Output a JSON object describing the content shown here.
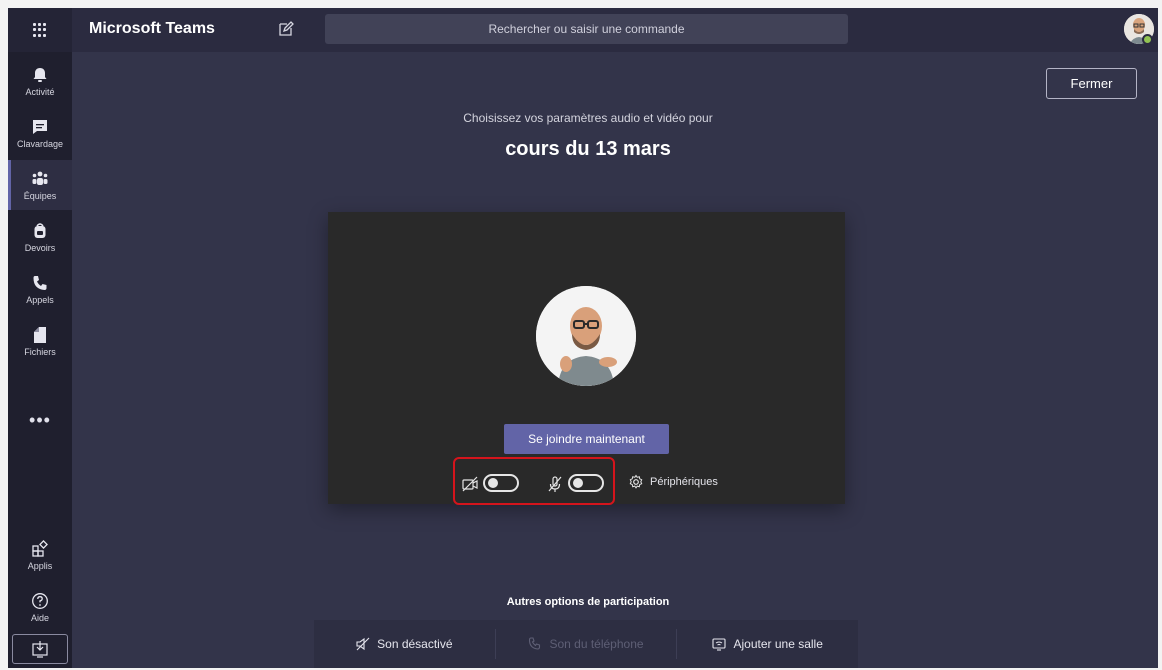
{
  "topbar": {
    "app_title": "Microsoft Teams",
    "search_placeholder": "Rechercher ou saisir une commande"
  },
  "sidebar": {
    "items": [
      {
        "label": "Activité",
        "icon": "bell-icon"
      },
      {
        "label": "Clavardage",
        "icon": "chat-icon"
      },
      {
        "label": "Équipes",
        "icon": "teams-icon",
        "active": true
      },
      {
        "label": "Devoirs",
        "icon": "backpack-icon"
      },
      {
        "label": "Appels",
        "icon": "phone-icon"
      },
      {
        "label": "Fichiers",
        "icon": "file-icon"
      }
    ],
    "more": "•••",
    "apps_label": "Applis",
    "help_label": "Aide"
  },
  "main": {
    "close_label": "Fermer",
    "subtitle": "Choisissez vos paramètres audio et vidéo pour",
    "meeting_title": "cours du 13 mars",
    "join_label": "Se joindre maintenant",
    "video_toggle_on": false,
    "audio_toggle_on": false,
    "devices_label": "Périphériques",
    "other_options_title": "Autres options de participation",
    "options": [
      {
        "label": "Son désactivé",
        "icon": "speaker-off-icon",
        "enabled": true
      },
      {
        "label": "Son du téléphone",
        "icon": "phone-icon",
        "enabled": false
      },
      {
        "label": "Ajouter une salle",
        "icon": "room-icon",
        "enabled": true
      }
    ]
  },
  "colors": {
    "accent": "#6264a7",
    "highlight": "#d4141c",
    "background": "#33344a",
    "presence": "#92c353"
  }
}
